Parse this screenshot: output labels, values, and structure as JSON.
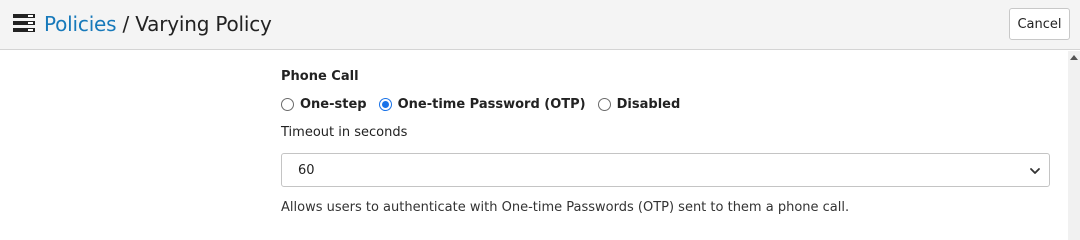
{
  "header": {
    "icon": "policy-list-icon",
    "breadcrumb_link": "Policies",
    "separator": " / ",
    "current_page": "Varying Policy",
    "cancel_label": "Cancel",
    "link_color": "#1779ba"
  },
  "form": {
    "section_label": "Phone Call",
    "radio_options": [
      {
        "label": "One-step",
        "checked": false
      },
      {
        "label": "One-time Password (OTP)",
        "checked": true
      },
      {
        "label": "Disabled",
        "checked": false
      }
    ],
    "timeout_label": "Timeout in seconds",
    "timeout_value": "60",
    "help_text": "Allows users to authenticate with One-time Passwords (OTP) sent to them a phone call.",
    "accent_color": "#1a73e8"
  }
}
